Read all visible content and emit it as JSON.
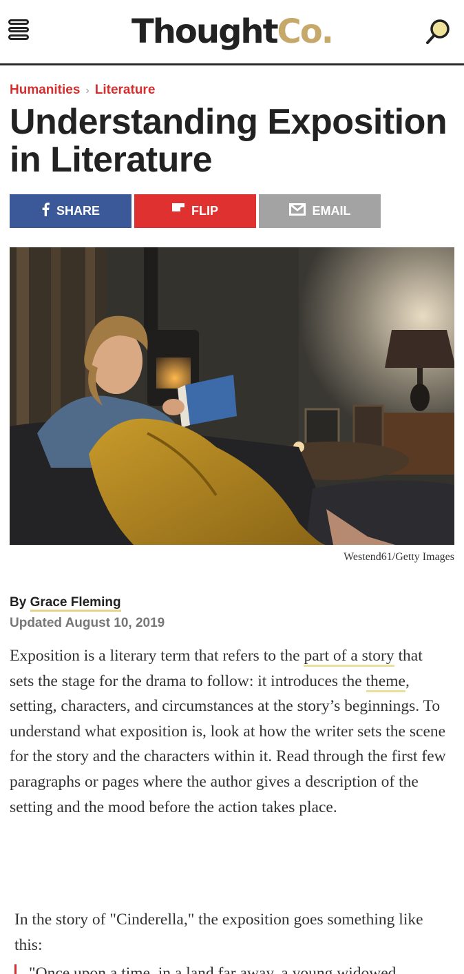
{
  "header": {
    "logo_main": "Thought",
    "logo_accent": "Co.",
    "menu_icon": "hamburger-menu-icon",
    "search_icon": "search-icon"
  },
  "breadcrumb": {
    "items": [
      "Humanities",
      "Literature"
    ],
    "separator": "›"
  },
  "article": {
    "title": "Understanding Exposition in Literature",
    "image_credit": "Westend61/Getty Images",
    "byline_prefix": "By",
    "author": "Grace Fleming",
    "updated": "Updated August 10, 2019",
    "p1_a": "Exposition is a literary term that refers to the ",
    "p1_link1": "part of a story",
    "p1_b": " that sets the stage for the drama to follow: it introduces the ",
    "p1_link2": "theme",
    "p1_c": ", setting, characters, and circumstances at the story’s beginnings. To understand what exposition is, look at how the writer sets the scene for the story and the characters within it. Read through the first few paragraphs or pages where the author gives a description of the setting and the mood before the action takes place.",
    "p2": "In the story of \"Cinderella,\" the exposition goes something like this:",
    "quote": "\"Once upon a time, in a land far away, a young widowed gentleman"
  },
  "share": {
    "share_label": "SHARE",
    "flip_label": "FLIP",
    "email_label": "EMAIL"
  },
  "colors": {
    "accent_red": "#d32f2f",
    "facebook_blue": "#3b5998",
    "flip_red": "#e03131",
    "email_gray": "#a3a3a3",
    "logo_gold": "#c5a86a",
    "link_highlight": "#ecdf9c"
  }
}
